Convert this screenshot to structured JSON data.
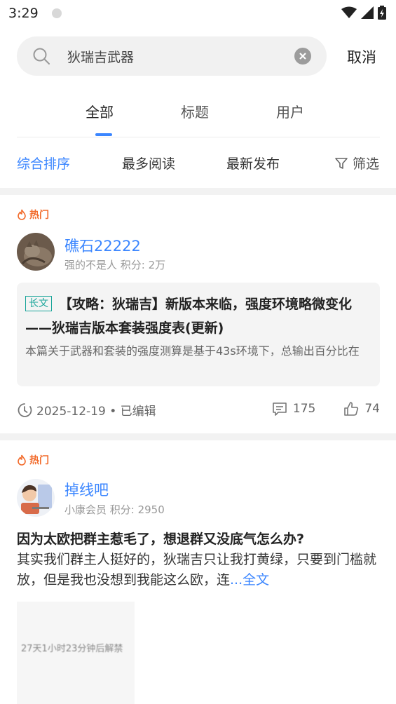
{
  "status_bar": {
    "time": "3:29"
  },
  "search": {
    "query": "狄瑞吉武器",
    "cancel_label": "取消"
  },
  "tabs": [
    {
      "label": "全部",
      "active": true
    },
    {
      "label": "标题",
      "active": false
    },
    {
      "label": "用户",
      "active": false
    }
  ],
  "sort": {
    "items": [
      "综合排序",
      "最多阅读",
      "最新发布"
    ],
    "filter_label": "筛选"
  },
  "posts": [
    {
      "hot_label": "热门",
      "username": "礁石22222",
      "usermeta": "强的不是人 积分: 2万",
      "badge": "长文",
      "title": "【攻略：狄瑞吉】新版本来临，强度环境略微变化——狄瑞吉版本套装强度表(更新)",
      "summary": "本篇关于武器和套装的强度测算是基于43s环境下，总输出百分比在",
      "date": "2025-12-19 • 已编辑",
      "comments": "175",
      "likes": "74"
    },
    {
      "hot_label": "热门",
      "username": "掉线吧",
      "usermeta": "小康会员 积分: 2950",
      "title": "因为太欧把群主惹毛了，想退群又没底气怎么办?",
      "body": "其实我们群主人挺好的，狄瑞吉只让我打黄绿，只要到门槛就放，但是我也没想到我能这么欧，连",
      "read_more": "...全文",
      "image_text": "27天1小时23分钟后解禁"
    }
  ],
  "colors": {
    "accent": "#3b86ff",
    "hot": "#f26a2a",
    "badge": "#1aa59a"
  }
}
